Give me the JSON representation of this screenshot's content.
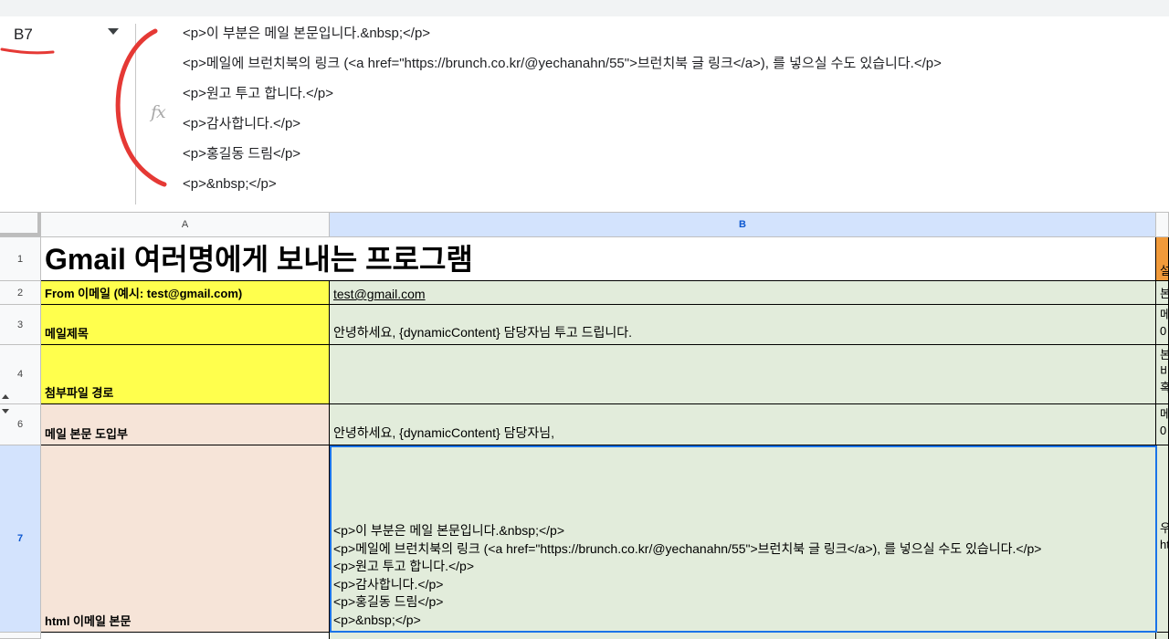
{
  "formula_bar": {
    "cell_ref": "B7",
    "fx_label": "fx",
    "lines": [
      "<p>이 부분은 메일 본문입니다.&nbsp;</p>",
      "<p>메일에 브런치북의 링크 (<a href=\"https://brunch.co.kr/@yechanahn/55\">브런치북 글 링크</a>), 를 넣으실 수도 있습니다.</p>",
      "<p>원고 투고 합니다.</p>",
      "<p>감사합니다.</p>",
      "<p>홍길동 드림</p>",
      "<p>&nbsp;</p>"
    ]
  },
  "annotation_color": "#e53935",
  "columns": [
    "A",
    "B"
  ],
  "rows": {
    "r1": {
      "num": "1",
      "a": "Gmail 여러명에게 보내는 프로그램",
      "c": "설"
    },
    "r2": {
      "num": "2",
      "a": "From 이메일 (예시: test@gmail.com)",
      "b": "test@gmail.com",
      "c": "본"
    },
    "r3": {
      "num": "3",
      "a": "메일제목",
      "b": "안녕하세요, {dynamicContent} 담당자님 투고 드립니다.",
      "c": [
        "메",
        "0"
      ]
    },
    "r4": {
      "num": "4",
      "a": "첨부파일 경로",
      "b": "",
      "c": [
        "본",
        "비",
        "혹"
      ]
    },
    "r6": {
      "num": "6",
      "a": "메일 본문 도입부",
      "b": "안녕하세요, {dynamicContent} 담당자님,",
      "c": [
        "메",
        "0"
      ]
    },
    "r7": {
      "num": "7",
      "a": "html 이메일 본문",
      "b_lines": [
        "<p>이 부분은 메일 본문입니다.&nbsp;</p>",
        "<p>메일에 브런치북의 링크 (<a href=\"https://brunch.co.kr/@yechanahn/55\">브런치북 글 링크</a>), 를 넣으실 수도 있습니다.</p>",
        "<p>원고 투고 합니다.</p>",
        "<p>감사합니다.</p>",
        "<p>홍길동 드림</p>",
        "<p>&nbsp;</p>"
      ],
      "c": [
        "우",
        "ht"
      ]
    }
  },
  "colors": {
    "yellow": "#ffff4d",
    "green": "#e2ecdb",
    "peach": "#f6e4d8",
    "orange": "#f19a3a",
    "selection": "#1a73e8",
    "header_selected": "#d3e3fd"
  }
}
